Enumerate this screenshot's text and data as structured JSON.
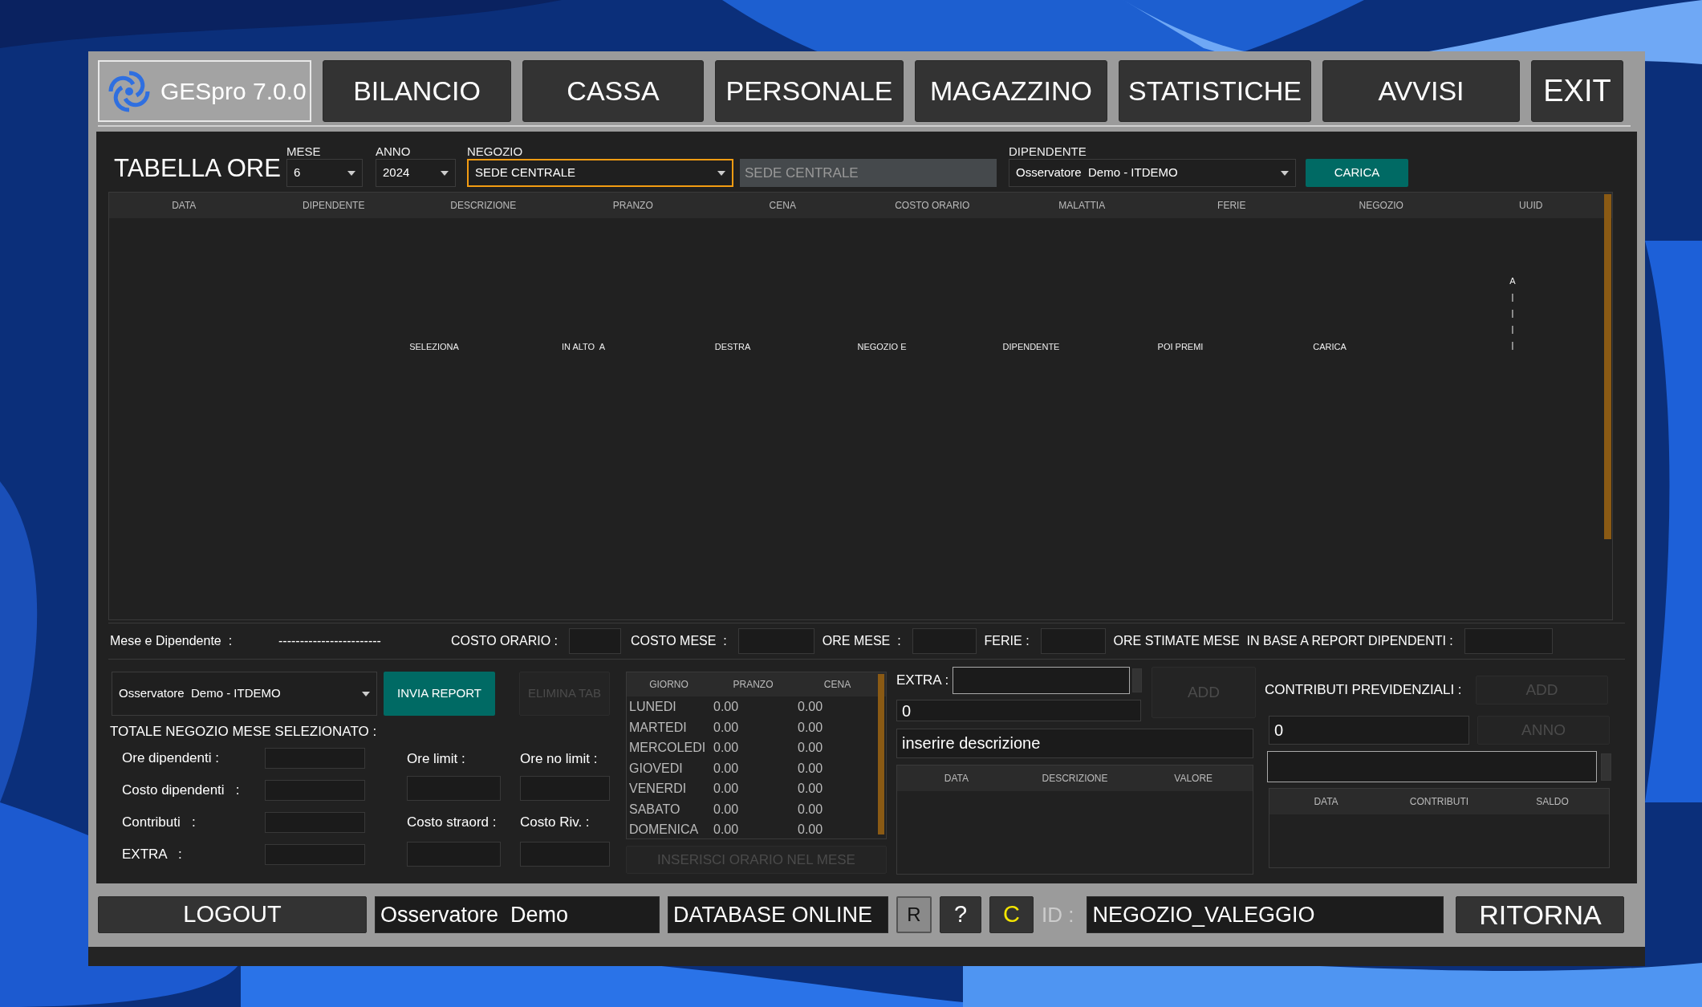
{
  "nav": {
    "logo_text": "GESpro 7.0.0",
    "buttons": [
      "BILANCIO",
      "CASSA",
      "PERSONALE",
      "MAGAZZINO",
      "STATISTICHE",
      "AVVISI"
    ],
    "exit": "EXIT"
  },
  "filters": {
    "title": "TABELLA ORE",
    "mese": {
      "label": "MESE",
      "value": "6"
    },
    "anno": {
      "label": "ANNO",
      "value": "2024"
    },
    "negozio": {
      "label": "NEGOZIO",
      "value": "SEDE CENTRALE",
      "focused": true
    },
    "negozio_display": "SEDE CENTRALE",
    "dipendente": {
      "label": "DIPENDENTE",
      "value": "Osservatore  Demo - ITDEMO"
    },
    "load_button": "CARICA"
  },
  "hours_table": {
    "columns": [
      "DATA",
      "DIPENDENTE",
      "DESCRIZIONE",
      "PRANZO",
      "CENA",
      "COSTO ORARIO",
      "MALATTIA",
      "FERIE",
      "NEGOZIO",
      "UUID"
    ],
    "hint": [
      "SELEZIONA",
      "IN ALTO  A",
      "DESTRA",
      "NEGOZIO E",
      "DIPENDENTE",
      "POI PREMI",
      "CARICA"
    ],
    "hint_vertical": [
      "A",
      "|",
      "|",
      "|",
      "|"
    ]
  },
  "summary": {
    "label": "Mese e Dipendente  :",
    "value": "------------------------",
    "fields": [
      {
        "label": "COSTO ORARIO :"
      },
      {
        "label": "COSTO MESE  :"
      },
      {
        "label": "ORE MESE  :"
      },
      {
        "label": "FERIE :"
      },
      {
        "label": "ORE STIMATE MESE  IN BASE A REPORT DIPENDENTI :"
      }
    ]
  },
  "report": {
    "employee_select": "Osservatore  Demo - ITDEMO",
    "send_button": {
      "label": "INVIA REPORT",
      "disabled": false
    },
    "delete_button": {
      "label": "ELIMINA TAB",
      "disabled": true
    },
    "totals_title": "TOTALE NEGOZIO MESE SELEZIONATO :",
    "totals": [
      "Ore dipendenti :",
      "Costo dipendenti   :",
      "Contributi   :",
      "EXTRA   :"
    ],
    "limits": [
      "Ore limit   :",
      "Ore no limit   :",
      "Costo straord  :",
      "Costo Riv.   :"
    ]
  },
  "schedule": {
    "columns": [
      "GIORNO",
      "PRANZO",
      "CENA"
    ],
    "rows": [
      [
        "LUNEDI",
        "0.00",
        "0.00"
      ],
      [
        "MARTEDI",
        "0.00",
        "0.00"
      ],
      [
        "MERCOLEDI",
        "0.00",
        "0.00"
      ],
      [
        "GIOVEDI",
        "0.00",
        "0.00"
      ],
      [
        "VENERDI",
        "0.00",
        "0.00"
      ],
      [
        "SABATO",
        "0.00",
        "0.00"
      ],
      [
        "DOMENICA",
        "0.00",
        "0.00"
      ]
    ],
    "insert_button": {
      "label": "INSERISCI ORARIO NEL MESE",
      "disabled": true
    }
  },
  "extra": {
    "label": "EXTRA :",
    "amount": "0",
    "description": "inserire descrizione",
    "add_button": {
      "label": "ADD",
      "disabled": true
    },
    "columns": [
      "DATA",
      "DESCRIZIONE",
      "VALORE"
    ]
  },
  "contributions": {
    "label": "CONTRIBUTI PREVIDENZIALI :",
    "add_button": {
      "label": "ADD",
      "disabled": true
    },
    "amount": "0",
    "year_button": {
      "label": "ANNO",
      "disabled": true
    },
    "columns": [
      "DATA",
      "CONTRIBUTI",
      "SALDO"
    ]
  },
  "status_bar": {
    "logout": "LOGOUT",
    "user": "Osservatore  Demo",
    "database": "DATABASE ONLINE",
    "buttons": [
      {
        "label": "R",
        "kind": "outlined"
      },
      {
        "label": "?",
        "kind": "plain"
      },
      {
        "label": "C",
        "kind": "highlight"
      }
    ],
    "id_label": "ID :",
    "store": "NEGOZIO_VALEGGIO",
    "back": "RITORNA"
  }
}
